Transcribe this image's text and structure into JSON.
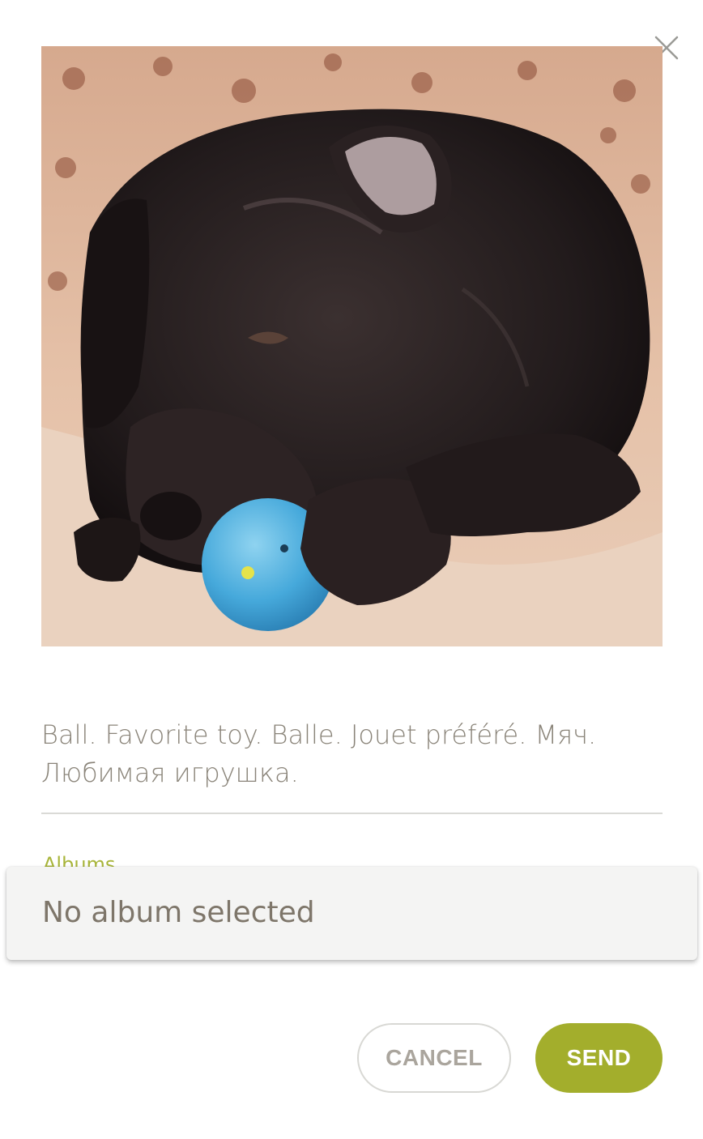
{
  "dialog": {
    "close_icon": "close-icon",
    "photo": {
      "description_icon": "dog-photo"
    },
    "caption": {
      "line1": "Ball. Favorite toy. Balle. Jouet préféré. Мяч.",
      "line2": "Любимая игрушка."
    },
    "albums": {
      "label": "Albums",
      "selected_value": "No album selected"
    },
    "buttons": {
      "cancel_label": "CANCEL",
      "send_label": "SEND"
    },
    "colors": {
      "accent": "#a3ae2c",
      "text_muted": "#8a8479",
      "divider": "#dadad6",
      "dropdown_bg": "#f4f4f3"
    }
  }
}
